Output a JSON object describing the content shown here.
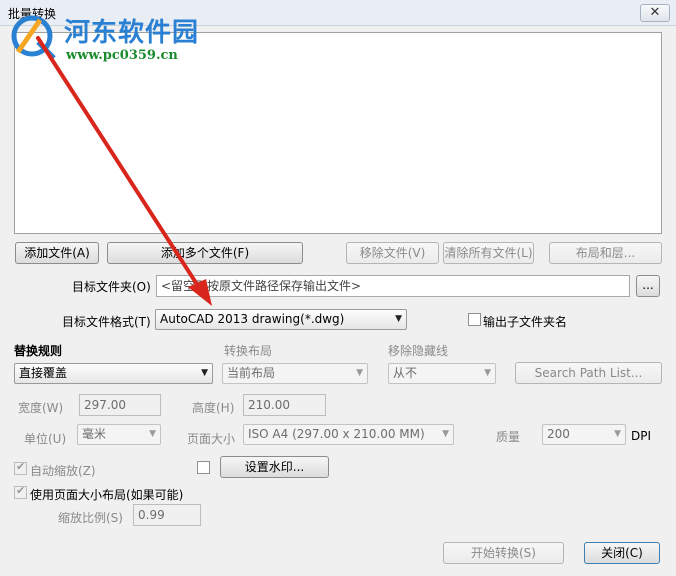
{
  "window": {
    "title": "批量转换",
    "close_glyph": "✕"
  },
  "watermark": {
    "title": "河东软件园",
    "url": "www.pc0359.cn"
  },
  "file_buttons": {
    "add_file": "添加文件(A)",
    "add_multiple": "添加多个文件(F)",
    "remove_file": "移除文件(V)",
    "clear_all": "清除所有文件(L)",
    "layout_layers": "布局和层..."
  },
  "target_folder": {
    "label": "目标文件夹(O)",
    "placeholder": "<留空则按原文件路径保存输出文件>",
    "browse": "..."
  },
  "target_format": {
    "label": "目标文件格式(T)",
    "value": "AutoCAD 2013 drawing(*.dwg)",
    "output_subfolder": "输出子文件夹名"
  },
  "replace_rule": {
    "label": "替换规则",
    "value": "直接覆盖"
  },
  "convert_layout": {
    "label": "转换布局",
    "value": "当前布局"
  },
  "remove_hidden": {
    "label": "移除隐藏线",
    "value": "从不"
  },
  "search_path_button": "Search Path List...",
  "width": {
    "label": "宽度(W)",
    "value": "297.00"
  },
  "height": {
    "label": "高度(H)",
    "value": "210.00"
  },
  "unit": {
    "label": "单位(U)",
    "value": "毫米"
  },
  "page_size": {
    "label": "页面大小",
    "value": "ISO A4 (297.00 x 210.00 MM)"
  },
  "quality": {
    "label": "质量",
    "value": "200",
    "unit": "DPI"
  },
  "auto_zoom": {
    "label": "自动缩放(Z)",
    "checked": true
  },
  "watermark_button": "设置水印...",
  "use_page_layout": {
    "label": "使用页面大小布局(如果可能)",
    "checked": true
  },
  "scale": {
    "label": "缩放比例(S)",
    "value": "0.99"
  },
  "footer": {
    "start": "开始转换(S)",
    "close": "关闭(C)"
  },
  "colors": {
    "annotation_arrow": "#d9261c",
    "watermark_blue": "#2a80d2",
    "watermark_green": "#1b8c2e"
  }
}
